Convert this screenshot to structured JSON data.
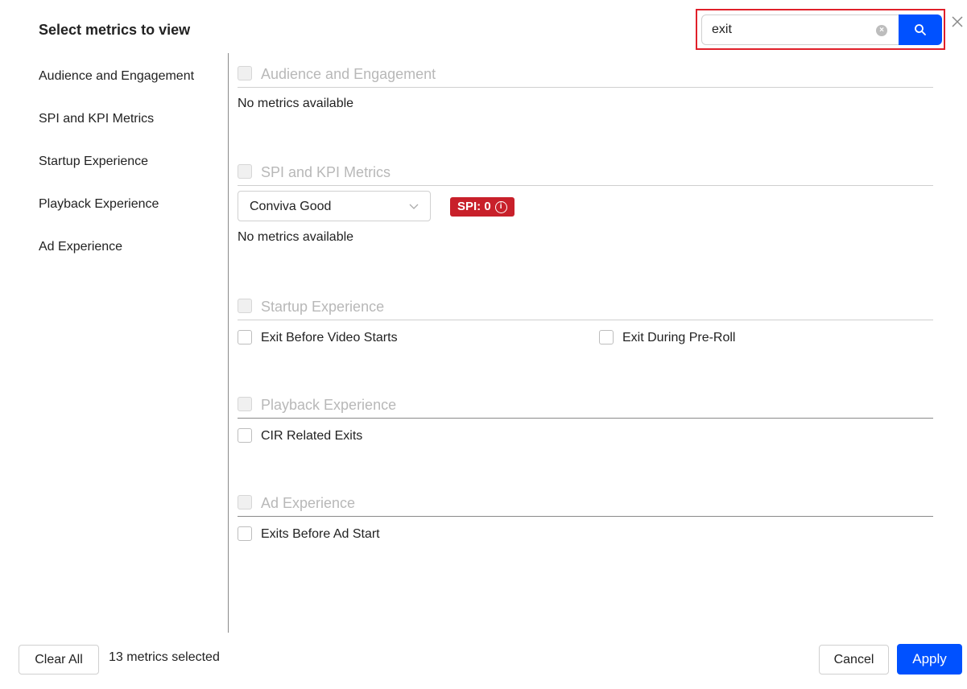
{
  "header": {
    "title": "Select metrics to view"
  },
  "search": {
    "value": "exit",
    "placeholder": ""
  },
  "sidebar": {
    "items": [
      {
        "label": "Audience and Engagement"
      },
      {
        "label": "SPI and KPI Metrics"
      },
      {
        "label": "Startup Experience"
      },
      {
        "label": "Playback Experience"
      },
      {
        "label": "Ad Experience"
      }
    ]
  },
  "sections": {
    "audience": {
      "title": "Audience and Engagement",
      "empty": "No metrics available"
    },
    "spi": {
      "title": "SPI and KPI Metrics",
      "select_value": "Conviva Good",
      "badge": "SPI: 0",
      "empty": "No metrics available"
    },
    "startup": {
      "title": "Startup Experience",
      "metrics": [
        "Exit Before Video Starts",
        "Exit During Pre-Roll"
      ]
    },
    "playback": {
      "title": "Playback Experience",
      "metrics": [
        "CIR Related Exits"
      ]
    },
    "ad": {
      "title": "Ad Experience",
      "metrics": [
        "Exits Before Ad Start"
      ]
    }
  },
  "footer": {
    "clear_label": "Clear All",
    "count_text": "13 metrics selected",
    "cancel_label": "Cancel",
    "apply_label": "Apply"
  },
  "colors": {
    "primary": "#0051ff",
    "badge": "#c8202a",
    "highlight": "#e0202a"
  },
  "icons": {
    "search": "search-icon",
    "clear": "clear-input-icon",
    "close": "close-icon",
    "chevron": "chevron-down-icon",
    "info": "info-icon"
  }
}
